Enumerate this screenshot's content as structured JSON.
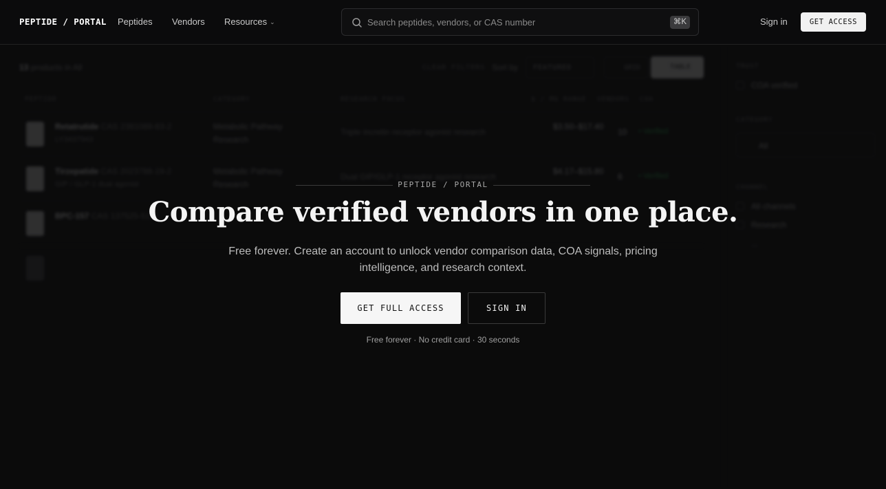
{
  "header": {
    "brand": "PEPTIDE / PORTAL",
    "nav": {
      "peptides": "Peptides",
      "vendors": "Vendors",
      "resources": "Resources"
    },
    "search": {
      "placeholder": "Search peptides, vendors, or CAS number",
      "shortcut": "⌘K"
    },
    "sign_in": "Sign in",
    "get_access": "GET ACCESS"
  },
  "catalog": {
    "count_number": "13",
    "count_text": "products in All",
    "clear_filters": "CLEAR FILTERS",
    "sort_label": "Sort by",
    "sort_value": "FEATURED",
    "view_grid": "GRID",
    "view_table": "TABLE",
    "columns": [
      "PEPTIDE",
      "CATEGORY",
      "RESEARCH FOCUS",
      "$ / MG RANGE",
      "VENDORS",
      "COA"
    ],
    "rows": [
      {
        "name": "Retatrutide",
        "cas": "CAS 2381089-83-2",
        "code": "LY3437943",
        "category": "Metabolic Pathway Research",
        "focus": "Triple incretin receptor agonist research",
        "price": "$3.50–$17.40",
        "vendors": "10",
        "coa": "• Verified"
      },
      {
        "name": "Tirzepatide",
        "cas": "CAS 2023788-19-2",
        "code": "GIP / GLP-1 dual agonist",
        "category": "Metabolic Pathway Research",
        "focus": "Dual GIP/GLP-1 receptor agonist research",
        "price": "$4.17–$15.80",
        "vendors": "6",
        "coa": "• Verified"
      },
      {
        "name": "BPC-157",
        "cas": "CAS 137525-51-0",
        "code": "",
        "category": "",
        "focus": "",
        "price": "",
        "vendors": "",
        "coa": ""
      }
    ]
  },
  "sidebar": {
    "trust_heading": "TRUST",
    "coa_verified": "COA verified",
    "category_heading": "CATEGORY",
    "category_value": "All",
    "channel_heading": "CHANNEL",
    "channels": [
      "All channels",
      "Research",
      "..."
    ]
  },
  "gate": {
    "eyebrow": "PEPTIDE / PORTAL",
    "headline": "Compare verified vendors in one place.",
    "subtext": "Free forever. Create an account to unlock vendor comparison data, COA signals, pricing intelligence, and research context.",
    "primary_cta": "GET FULL ACCESS",
    "secondary_cta": "SIGN IN",
    "note": "Free forever · No credit card · 30 seconds"
  }
}
